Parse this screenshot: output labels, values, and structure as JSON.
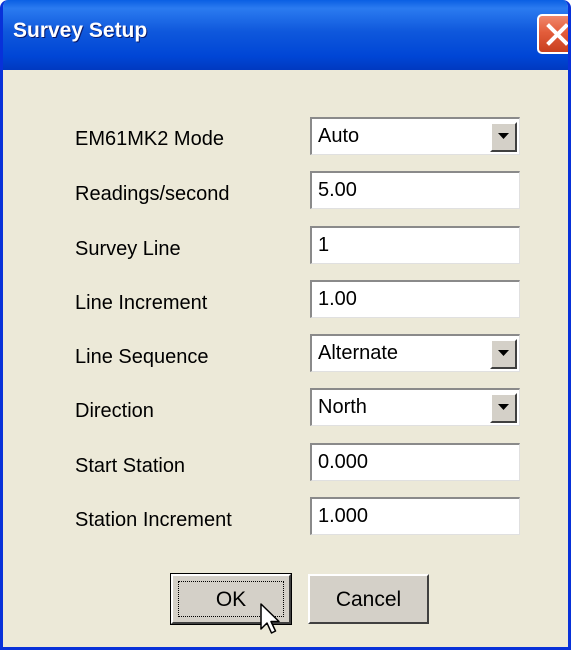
{
  "window": {
    "title": "Survey Setup"
  },
  "fields": [
    {
      "label": "EM61MK2 Mode",
      "value": "Auto",
      "type": "dropdown"
    },
    {
      "label": "Readings/second",
      "value": "5.00",
      "type": "text"
    },
    {
      "label": "Survey Line",
      "value": "1",
      "type": "text"
    },
    {
      "label": "Line Increment",
      "value": "1.00",
      "type": "text"
    },
    {
      "label": "Line Sequence",
      "value": "Alternate",
      "type": "dropdown"
    },
    {
      "label": "Direction",
      "value": "North",
      "type": "dropdown"
    },
    {
      "label": "Start Station",
      "value": "0.000",
      "type": "text"
    },
    {
      "label": "Station Increment",
      "value": "1.000",
      "type": "text"
    }
  ],
  "buttons": {
    "ok": "OK",
    "cancel": "Cancel"
  },
  "icons": {
    "close": "close-icon",
    "dropdown": "chevron-down-icon",
    "cursor": "mouse-pointer-icon"
  },
  "colors": {
    "titlebar": "#0046d6",
    "dialog_bg": "#ece9d8",
    "close_button": "#e35d3b"
  }
}
